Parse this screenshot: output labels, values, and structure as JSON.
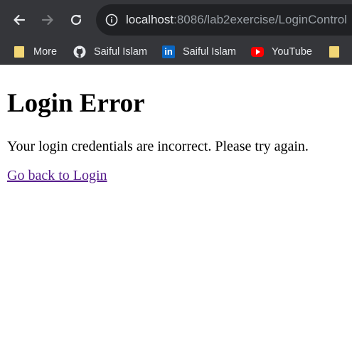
{
  "browser": {
    "url_host": "localhost",
    "url_rest": ":8086/lab2exercise/LoginControl",
    "bookmarks": [
      {
        "label": "More",
        "icon": "folder-icon"
      },
      {
        "label": "Saiful Islam",
        "icon": "github-icon"
      },
      {
        "label": "Saiful Islam",
        "icon": "linkedin-icon"
      },
      {
        "label": "YouTube",
        "icon": "youtube-icon"
      },
      {
        "label": "",
        "icon": "folder-icon"
      }
    ]
  },
  "page": {
    "heading": "Login Error",
    "message": "Your login credentials are incorrect. Please try again.",
    "link_text": "Go back to Login"
  },
  "colors": {
    "toolbar_bg": "#35363a",
    "omnibox_bg": "#202124",
    "link": "#551a8b"
  }
}
